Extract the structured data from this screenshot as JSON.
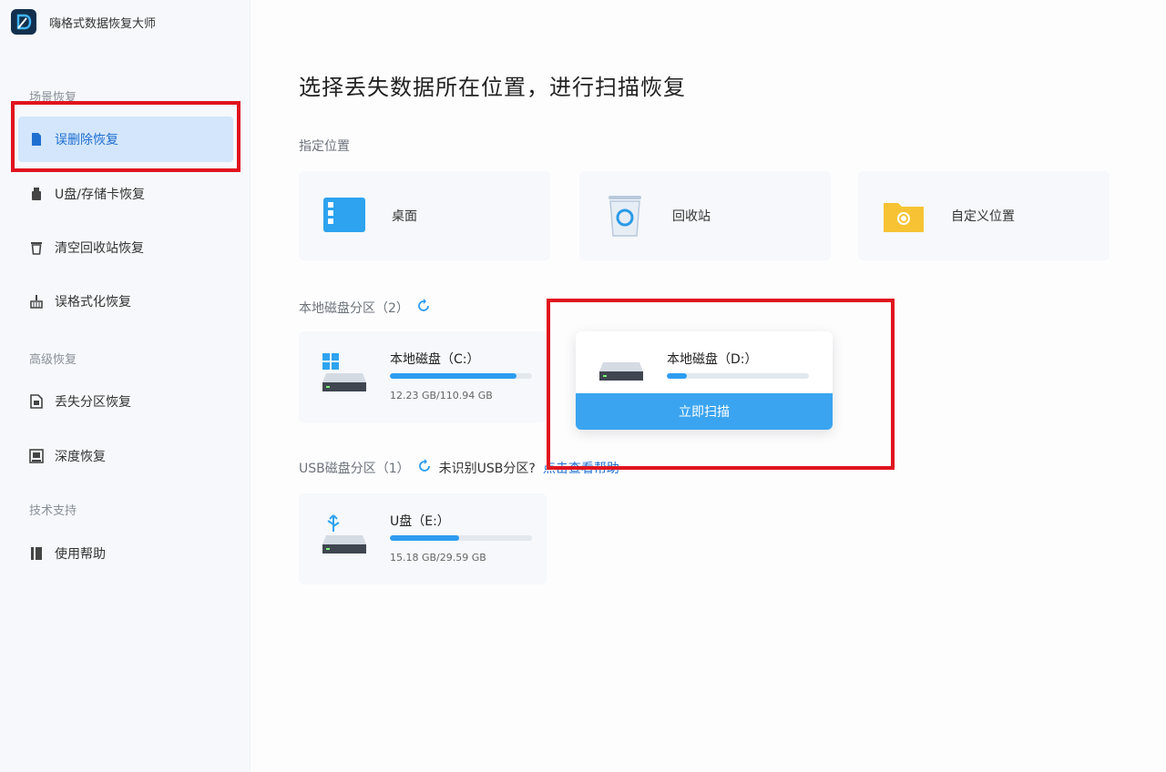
{
  "app": {
    "title": "嗨格式数据恢复大师"
  },
  "sidebar": {
    "groups": [
      {
        "label": "场景恢复",
        "items": [
          {
            "label": "误删除恢复",
            "icon": "file-icon",
            "active": true
          },
          {
            "label": "U盘/存储卡恢复",
            "icon": "usb-drive-icon",
            "active": false
          },
          {
            "label": "清空回收站恢复",
            "icon": "trash-icon",
            "active": false
          },
          {
            "label": "误格式化恢复",
            "icon": "broom-icon",
            "active": false
          }
        ]
      },
      {
        "label": "高级恢复",
        "items": [
          {
            "label": "丢失分区恢复",
            "icon": "partition-icon",
            "active": false
          },
          {
            "label": "深度恢复",
            "icon": "deep-scan-icon",
            "active": false
          }
        ]
      },
      {
        "label": "技术支持",
        "items": [
          {
            "label": "使用帮助",
            "icon": "book-icon",
            "active": false
          }
        ]
      }
    ]
  },
  "main": {
    "title": "选择丢失数据所在位置，进行扫描恢复",
    "locations": {
      "label": "指定位置",
      "items": [
        {
          "label": "桌面",
          "icon": "desktop-icon"
        },
        {
          "label": "回收站",
          "icon": "recycle-bin-icon"
        },
        {
          "label": "自定义位置",
          "icon": "folder-search-icon"
        }
      ]
    },
    "local_disks": {
      "label": "本地磁盘分区（2）",
      "items": [
        {
          "name": "本地磁盘（C:）",
          "size": "12.23 GB/110.94 GB",
          "used_fraction": 0.89
        },
        {
          "name": "本地磁盘（D:）",
          "size": "",
          "used_fraction": 0.14,
          "scan_label": "立即扫描"
        }
      ]
    },
    "usb_disks": {
      "label": "USB磁盘分区（1）",
      "unrecognized": "未识别USB分区?",
      "help_link": "点击查看帮助",
      "items": [
        {
          "name": "U盘（E:）",
          "size": "15.18 GB/29.59 GB",
          "used_fraction": 0.49
        }
      ]
    }
  },
  "colors": {
    "accent": "#2d9cf0",
    "highlight": "#e0141f",
    "active_bg": "#d3e6fb"
  }
}
